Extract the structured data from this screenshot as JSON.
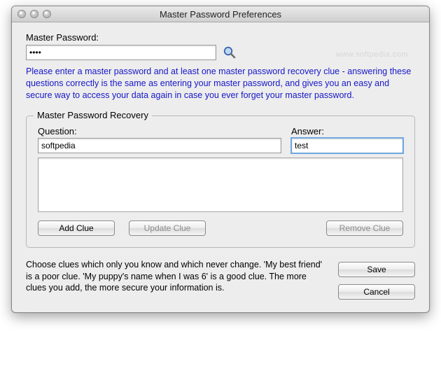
{
  "window": {
    "title": "Master Password Preferences"
  },
  "watermark": "www.softpedia.com",
  "master": {
    "label": "Master Password:",
    "value": "••••"
  },
  "icons": {
    "magnifier": "magnifier-icon"
  },
  "instructions": "Please enter a master password and at least one master password recovery clue - answering these questions correctly is the same as entering your master password, and gives you an easy and secure way to access your data again in case you ever forget your master password.",
  "recovery": {
    "legend": "Master Password Recovery",
    "question_label": "Question:",
    "answer_label": "Answer:",
    "question_value": "softpedia",
    "answer_value": "test",
    "buttons": {
      "add": "Add Clue",
      "update": "Update Clue",
      "remove": "Remove Clue"
    }
  },
  "footer": {
    "hint": "Choose clues which only you know and which never change. 'My best friend' is a poor clue. 'My puppy's name when I was 6' is a good clue. The more clues you add, the more secure your information is.",
    "save": "Save",
    "cancel": "Cancel"
  }
}
